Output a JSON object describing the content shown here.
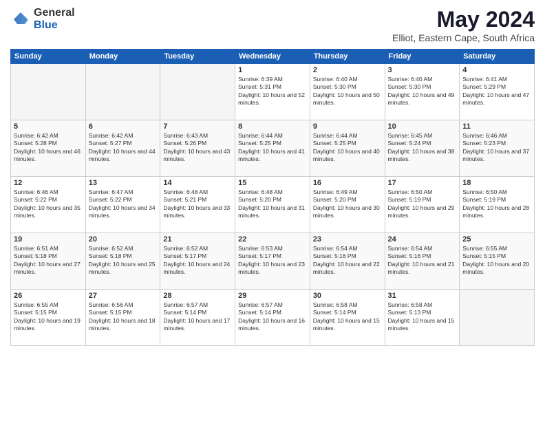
{
  "logo": {
    "general": "General",
    "blue": "Blue"
  },
  "title": "May 2024",
  "subtitle": "Elliot, Eastern Cape, South Africa",
  "headers": [
    "Sunday",
    "Monday",
    "Tuesday",
    "Wednesday",
    "Thursday",
    "Friday",
    "Saturday"
  ],
  "weeks": [
    [
      {
        "day": "",
        "info": ""
      },
      {
        "day": "",
        "info": ""
      },
      {
        "day": "",
        "info": ""
      },
      {
        "day": "1",
        "info": "Sunrise: 6:39 AM\nSunset: 5:31 PM\nDaylight: 10 hours and 52 minutes."
      },
      {
        "day": "2",
        "info": "Sunrise: 6:40 AM\nSunset: 5:30 PM\nDaylight: 10 hours and 50 minutes."
      },
      {
        "day": "3",
        "info": "Sunrise: 6:40 AM\nSunset: 5:30 PM\nDaylight: 10 hours and 49 minutes."
      },
      {
        "day": "4",
        "info": "Sunrise: 6:41 AM\nSunset: 5:29 PM\nDaylight: 10 hours and 47 minutes."
      }
    ],
    [
      {
        "day": "5",
        "info": "Sunrise: 6:42 AM\nSunset: 5:28 PM\nDaylight: 10 hours and 46 minutes."
      },
      {
        "day": "6",
        "info": "Sunrise: 6:42 AM\nSunset: 5:27 PM\nDaylight: 10 hours and 44 minutes."
      },
      {
        "day": "7",
        "info": "Sunrise: 6:43 AM\nSunset: 5:26 PM\nDaylight: 10 hours and 43 minutes."
      },
      {
        "day": "8",
        "info": "Sunrise: 6:44 AM\nSunset: 5:25 PM\nDaylight: 10 hours and 41 minutes."
      },
      {
        "day": "9",
        "info": "Sunrise: 6:44 AM\nSunset: 5:25 PM\nDaylight: 10 hours and 40 minutes."
      },
      {
        "day": "10",
        "info": "Sunrise: 6:45 AM\nSunset: 5:24 PM\nDaylight: 10 hours and 38 minutes."
      },
      {
        "day": "11",
        "info": "Sunrise: 6:46 AM\nSunset: 5:23 PM\nDaylight: 10 hours and 37 minutes."
      }
    ],
    [
      {
        "day": "12",
        "info": "Sunrise: 6:46 AM\nSunset: 5:22 PM\nDaylight: 10 hours and 35 minutes."
      },
      {
        "day": "13",
        "info": "Sunrise: 6:47 AM\nSunset: 5:22 PM\nDaylight: 10 hours and 34 minutes."
      },
      {
        "day": "14",
        "info": "Sunrise: 6:48 AM\nSunset: 5:21 PM\nDaylight: 10 hours and 33 minutes."
      },
      {
        "day": "15",
        "info": "Sunrise: 6:48 AM\nSunset: 5:20 PM\nDaylight: 10 hours and 31 minutes."
      },
      {
        "day": "16",
        "info": "Sunrise: 6:49 AM\nSunset: 5:20 PM\nDaylight: 10 hours and 30 minutes."
      },
      {
        "day": "17",
        "info": "Sunrise: 6:50 AM\nSunset: 5:19 PM\nDaylight: 10 hours and 29 minutes."
      },
      {
        "day": "18",
        "info": "Sunrise: 6:50 AM\nSunset: 5:19 PM\nDaylight: 10 hours and 28 minutes."
      }
    ],
    [
      {
        "day": "19",
        "info": "Sunrise: 6:51 AM\nSunset: 5:18 PM\nDaylight: 10 hours and 27 minutes."
      },
      {
        "day": "20",
        "info": "Sunrise: 6:52 AM\nSunset: 5:18 PM\nDaylight: 10 hours and 25 minutes."
      },
      {
        "day": "21",
        "info": "Sunrise: 6:52 AM\nSunset: 5:17 PM\nDaylight: 10 hours and 24 minutes."
      },
      {
        "day": "22",
        "info": "Sunrise: 6:53 AM\nSunset: 5:17 PM\nDaylight: 10 hours and 23 minutes."
      },
      {
        "day": "23",
        "info": "Sunrise: 6:54 AM\nSunset: 5:16 PM\nDaylight: 10 hours and 22 minutes."
      },
      {
        "day": "24",
        "info": "Sunrise: 6:54 AM\nSunset: 5:16 PM\nDaylight: 10 hours and 21 minutes."
      },
      {
        "day": "25",
        "info": "Sunrise: 6:55 AM\nSunset: 5:15 PM\nDaylight: 10 hours and 20 minutes."
      }
    ],
    [
      {
        "day": "26",
        "info": "Sunrise: 6:55 AM\nSunset: 5:15 PM\nDaylight: 10 hours and 19 minutes."
      },
      {
        "day": "27",
        "info": "Sunrise: 6:56 AM\nSunset: 5:15 PM\nDaylight: 10 hours and 18 minutes."
      },
      {
        "day": "28",
        "info": "Sunrise: 6:57 AM\nSunset: 5:14 PM\nDaylight: 10 hours and 17 minutes."
      },
      {
        "day": "29",
        "info": "Sunrise: 6:57 AM\nSunset: 5:14 PM\nDaylight: 10 hours and 16 minutes."
      },
      {
        "day": "30",
        "info": "Sunrise: 6:58 AM\nSunset: 5:14 PM\nDaylight: 10 hours and 15 minutes."
      },
      {
        "day": "31",
        "info": "Sunrise: 6:58 AM\nSunset: 5:13 PM\nDaylight: 10 hours and 15 minutes."
      },
      {
        "day": "",
        "info": ""
      }
    ]
  ]
}
